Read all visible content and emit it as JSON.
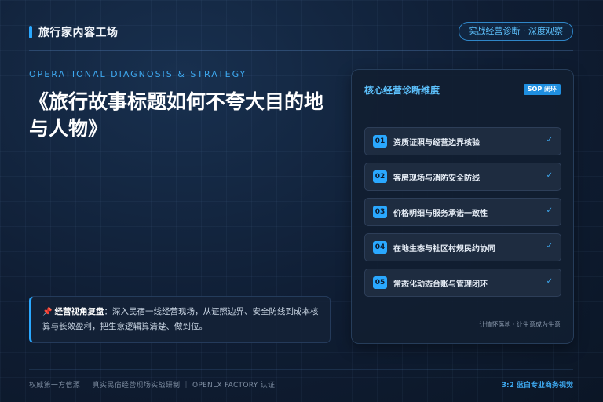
{
  "header": {
    "brand": "旅行家内容工场",
    "pill": "实战经营诊断 · 深度观察"
  },
  "hero": {
    "subtitle": "OPERATIONAL DIAGNOSIS & STRATEGY",
    "title": "《旅行故事标题如何不夸大目的地与人物》"
  },
  "note": {
    "icon": "pin-icon",
    "head": "经营视角复盘",
    "text": "：深入民宿一线经营现场，从证照边界、安全防线到成本核算与长效盈利，把生意逻辑算清楚、做到位。"
  },
  "panel": {
    "title": "核心经营诊断维度",
    "badge": "SOP 闭环",
    "items": [
      {
        "num": "01",
        "label": "资质证照与经营边界核验",
        "check": "✓"
      },
      {
        "num": "02",
        "label": "客房现场与消防安全防线",
        "check": "✓"
      },
      {
        "num": "03",
        "label": "价格明细与服务承诺一致性",
        "check": "✓"
      },
      {
        "num": "04",
        "label": "在地生态与社区村规民约协同",
        "check": "✓"
      },
      {
        "num": "05",
        "label": "常态化动态台账与管理闭环",
        "check": "✓"
      }
    ],
    "foot": "让情怀落地 · 让生意成为生意"
  },
  "footer": {
    "left": "权威第一方信源 ｜ 真实民宿经营现场实战研制 ｜ OPENLX FACTORY 认证",
    "right": "3:2 蓝白专业商务视觉"
  },
  "colors": {
    "accent": "#2aa8ff",
    "background": "#0e1a2e"
  }
}
